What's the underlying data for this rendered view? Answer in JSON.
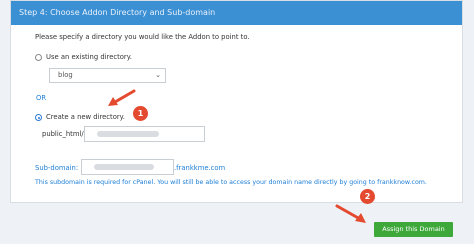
{
  "step_header": "Step 4: Choose Addon Directory and Sub-domain",
  "instruction": "Please specify a directory you would like the Addon to point to.",
  "existing_option": {
    "label": "Use an existing directory.",
    "selected_value": "blog"
  },
  "or_label": "OR",
  "new_option": {
    "label": "Create a new directory.",
    "path_prefix": "public_html/"
  },
  "subdomain": {
    "label": "Sub-domain:",
    "suffix": ".frankkme.com",
    "note": "This subdomain is required for cPanel. You will still be able to access your domain name directly by going to frankknow.com."
  },
  "submit_label": "Assign this Domain",
  "annotations": [
    "1",
    "2"
  ],
  "colors": {
    "header": "#3b8fd3",
    "link_blue": "#1c7ed6",
    "button_green": "#3ea83b",
    "annotation_red": "#e44a2f"
  }
}
